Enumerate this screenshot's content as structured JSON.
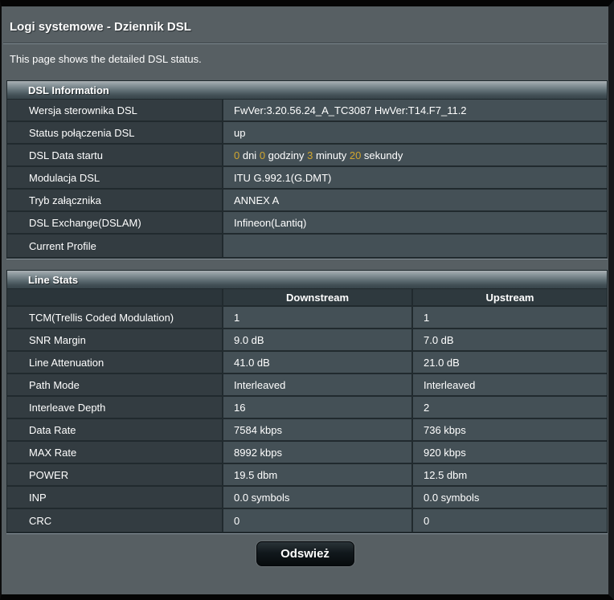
{
  "page": {
    "title": "Logi systemowe - Dziennik DSL",
    "subtitle": "This page shows the detailed DSL status."
  },
  "dsl_information": {
    "header": "DSL Information",
    "rows": [
      {
        "label": "Wersja sterownika DSL",
        "value": "FwVer:3.20.56.24_A_TC3087 HwVer:T14.F7_11.2"
      },
      {
        "label": "Status połączenia DSL",
        "value": "up"
      },
      {
        "label": "DSL Data startu",
        "parts": [
          {
            "text": "0",
            "hl": true
          },
          {
            "text": " dni ",
            "hl": false
          },
          {
            "text": "0",
            "hl": true
          },
          {
            "text": " godziny ",
            "hl": false
          },
          {
            "text": "3",
            "hl": true
          },
          {
            "text": " minuty ",
            "hl": false
          },
          {
            "text": "20",
            "hl": true
          },
          {
            "text": " sekundy",
            "hl": false
          }
        ]
      },
      {
        "label": "Modulacja DSL",
        "value": "ITU G.992.1(G.DMT)"
      },
      {
        "label": "Tryb załącznika",
        "value": "ANNEX A"
      },
      {
        "label": "DSL Exchange(DSLAM)",
        "value": "Infineon(Lantiq)"
      },
      {
        "label": "Current Profile",
        "value": ""
      }
    ]
  },
  "line_stats": {
    "header": "Line Stats",
    "columns": [
      "",
      "Downstream",
      "Upstream"
    ],
    "rows": [
      {
        "label": "TCM(Trellis Coded Modulation)",
        "downstream": "1",
        "upstream": "1"
      },
      {
        "label": "SNR Margin",
        "downstream": "9.0 dB",
        "upstream": "7.0 dB"
      },
      {
        "label": "Line Attenuation",
        "downstream": "41.0 dB",
        "upstream": "21.0 dB"
      },
      {
        "label": "Path Mode",
        "downstream": "Interleaved",
        "upstream": "Interleaved"
      },
      {
        "label": "Interleave Depth",
        "downstream": "16",
        "upstream": "2"
      },
      {
        "label": "Data Rate",
        "downstream": "7584 kbps",
        "upstream": "736 kbps"
      },
      {
        "label": "MAX Rate",
        "downstream": "8992 kbps",
        "upstream": "920 kbps"
      },
      {
        "label": "POWER",
        "downstream": "19.5 dbm",
        "upstream": "12.5 dbm"
      },
      {
        "label": "INP",
        "downstream": "0.0 symbols",
        "upstream": "0.0 symbols"
      },
      {
        "label": "CRC",
        "downstream": "0",
        "upstream": "0"
      }
    ]
  },
  "refresh_button": "Odswież",
  "colors": {
    "page_background": "#575F63",
    "label_cell_background": "#333C41",
    "value_cell_background": "#445056",
    "header_gradient_top": "#A9B0B4",
    "header_gradient_bottom": "#37444A",
    "uptime_number": "#D1A62F",
    "button_background": "#10161A",
    "text": "#FFFFFF"
  }
}
